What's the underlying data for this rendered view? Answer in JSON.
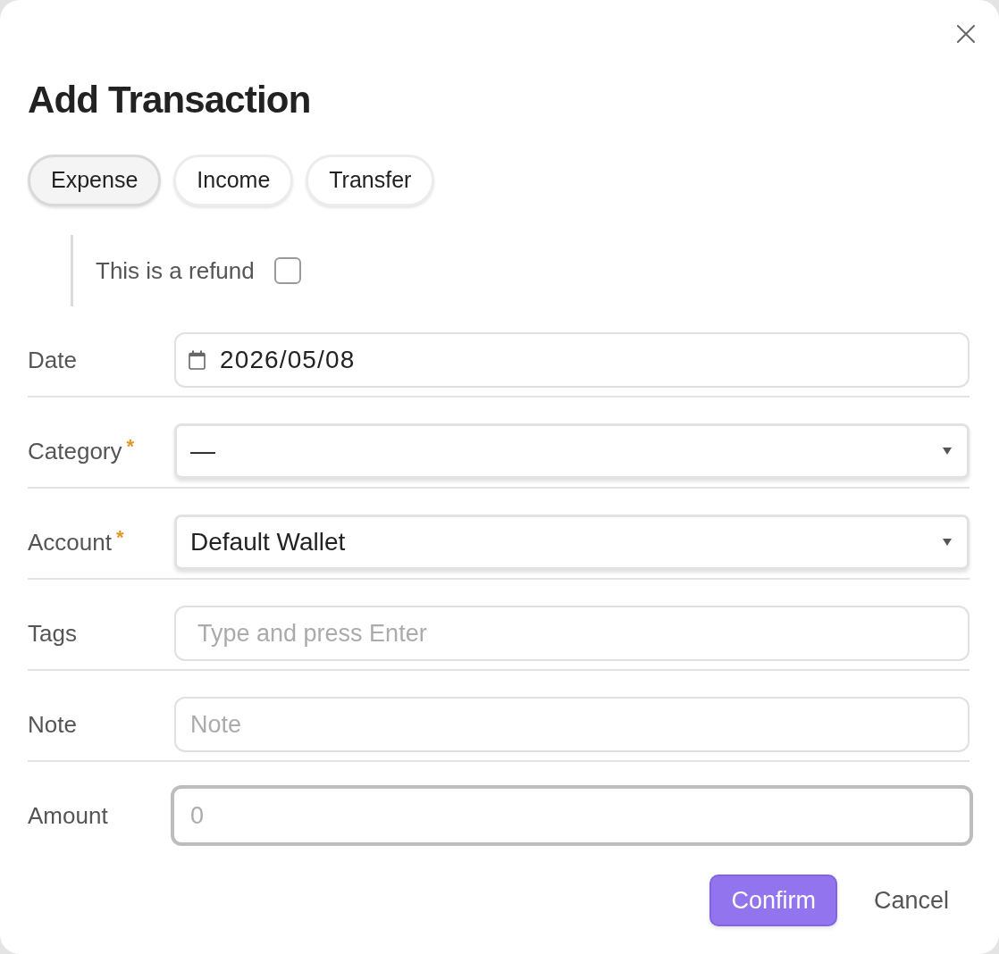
{
  "dialog": {
    "title": "Add Transaction"
  },
  "type_tabs": [
    {
      "label": "Expense",
      "selected": true
    },
    {
      "label": "Income",
      "selected": false
    },
    {
      "label": "Transfer",
      "selected": false
    }
  ],
  "refund": {
    "label": "This is a refund",
    "checked": false
  },
  "fields": [
    {
      "kind": "date",
      "label": "Date",
      "value": "2026/05/08",
      "focused": false
    },
    {
      "kind": "select",
      "label": "Category",
      "required_mark": "*",
      "value": "—",
      "focused": false
    },
    {
      "kind": "select",
      "label": "Account",
      "required_mark": "*",
      "value": "Default Wallet",
      "focused": false
    },
    {
      "kind": "tags",
      "label": "Tags",
      "placeholder": "Type and press Enter",
      "focused": false
    },
    {
      "kind": "text",
      "label": "Note",
      "placeholder": "Note",
      "focused": false
    },
    {
      "kind": "text",
      "label": "Amount",
      "placeholder": "0",
      "focused": true
    }
  ],
  "buttons": [
    {
      "kind": "primary",
      "label": "Confirm"
    },
    {
      "kind": "plain",
      "label": "Cancel"
    }
  ]
}
